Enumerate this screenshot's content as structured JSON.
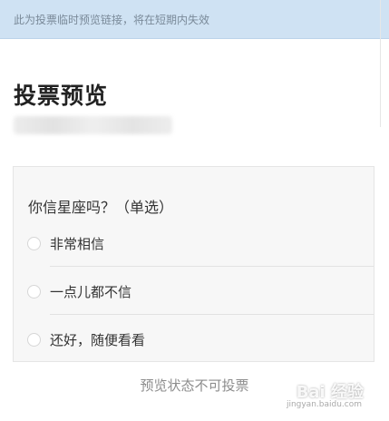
{
  "notice": {
    "text": "此为投票临时预览链接，将在短期内失效"
  },
  "page_title": "投票预览",
  "poll": {
    "question": "你信星座吗？（单选）",
    "options": [
      {
        "label": "非常相信"
      },
      {
        "label": "一点儿都不信"
      },
      {
        "label": "还好，随便看看"
      }
    ]
  },
  "footer_note": "预览状态不可投票",
  "watermark": {
    "logo_text": "Bai 经验",
    "url": "jingyan.baidu.com"
  }
}
